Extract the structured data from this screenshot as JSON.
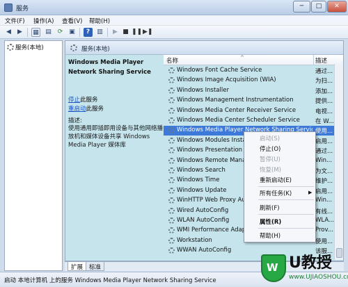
{
  "window": {
    "title": "服务",
    "minimize": "─",
    "maximize": "□",
    "close": "✕"
  },
  "menubar": [
    "文件(F)",
    "操作(A)",
    "查看(V)",
    "帮助(H)"
  ],
  "tree": {
    "root_label": "服务(本地)"
  },
  "header": {
    "label": "服务(本地)"
  },
  "description": {
    "service_name": "Windows Media Player Network Sharing Service",
    "stop_link": "停止",
    "stop_suffix": "此服务",
    "restart_link": "重启动",
    "restart_suffix": "此服务",
    "label": "描述:",
    "text": "使用通用即插即用设备与其他网络播放机和媒体设备共享 Windows Media Player 媒体库"
  },
  "columns": {
    "name": "名称",
    "description": "描述"
  },
  "services": [
    {
      "name": "Windows Font Cache Service",
      "desc": "通过..."
    },
    {
      "name": "Windows Image Acquisition (WIA)",
      "desc": "为扫..."
    },
    {
      "name": "Windows Installer",
      "desc": "添加..."
    },
    {
      "name": "Windows Management Instrumentation",
      "desc": "提供..."
    },
    {
      "name": "Windows Media Center Receiver Service",
      "desc": "电视..."
    },
    {
      "name": "Windows Media Center Scheduler Service",
      "desc": "在 W..."
    },
    {
      "name": "Windows Media Player Network Sharing Service",
      "desc": "使用..."
    },
    {
      "name": "Windows Modules Installer",
      "desc": "启用..."
    },
    {
      "name": "Windows Presentation Foundation Font Cache",
      "desc": "通过..."
    },
    {
      "name": "Windows Remote Management",
      "desc": "Win..."
    },
    {
      "name": "Windows Search",
      "desc": "为文..."
    },
    {
      "name": "Windows Time",
      "desc": "维护..."
    },
    {
      "name": "Windows Update",
      "desc": "启用..."
    },
    {
      "name": "WinHTTP Web Proxy Auto-Discovery",
      "desc": "Win..."
    },
    {
      "name": "Wired AutoConfig",
      "desc": "有线..."
    },
    {
      "name": "WLAN AutoConfig",
      "desc": "WLA..."
    },
    {
      "name": "WMI Performance Adapter",
      "desc": "Prov..."
    },
    {
      "name": "Workstation",
      "desc": "使用..."
    },
    {
      "name": "WWAN AutoConfig",
      "desc": "该服..."
    }
  ],
  "selected_index": 6,
  "context_menu": {
    "start": "启动(S)",
    "stop": "停止(O)",
    "pause": "暂停(U)",
    "resume": "恢复(M)",
    "restart": "重新启动(E)",
    "all_tasks": "所有任务(K)",
    "all_tasks_arrow": "▶",
    "refresh": "刷新(F)",
    "properties": "属性(R)",
    "help": "帮助(H)"
  },
  "tabs": [
    "扩展",
    "标准"
  ],
  "status": "启动 本地计算机 上的服务 Windows Media Player Network Sharing Service",
  "watermark": {
    "text": "U教授",
    "url": "www.UJIAOSHOU.com",
    "logo_letter": "W"
  }
}
